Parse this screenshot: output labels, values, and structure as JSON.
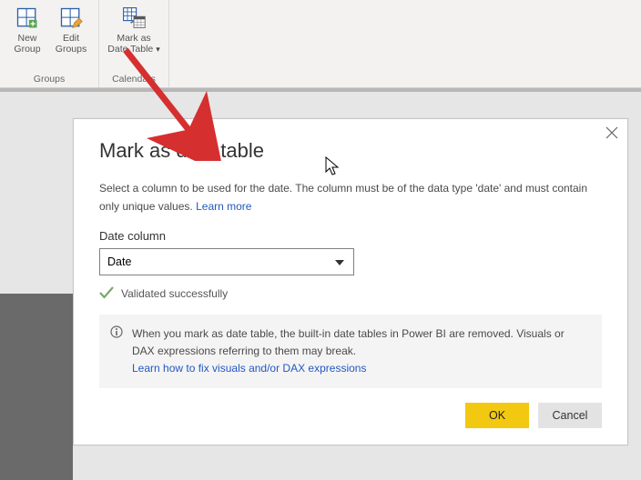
{
  "ribbon": {
    "groups": [
      {
        "name": "Groups",
        "buttons": [
          {
            "label_l1": "New",
            "label_l2": "Group"
          },
          {
            "label_l1": "Edit",
            "label_l2": "Groups"
          }
        ]
      },
      {
        "name": "Calendars",
        "buttons": [
          {
            "label_l1": "Mark as",
            "label_l2": "Date Table"
          }
        ]
      }
    ]
  },
  "dialog": {
    "title": "Mark as date table",
    "description": "Select a column to be used for the date. The column must be of the data type 'date' and must contain only unique values.",
    "learn_more": "Learn more",
    "field_label": "Date column",
    "selected_value": "Date",
    "validated_text": "Validated successfully",
    "info_text": "When you mark as date table, the built-in date tables in Power BI are removed. Visuals or DAX expressions referring to them may break.",
    "info_link": "Learn how to fix visuals and/or DAX expressions",
    "ok_label": "OK",
    "cancel_label": "Cancel"
  }
}
